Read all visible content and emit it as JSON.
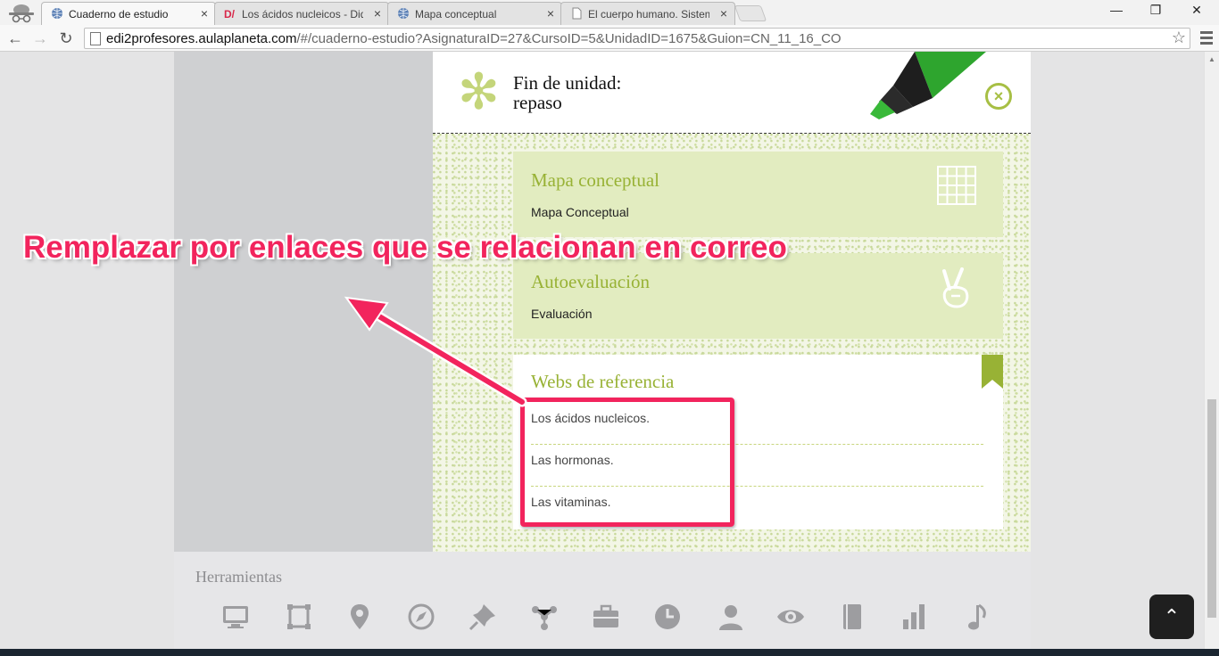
{
  "browser": {
    "tabs": [
      {
        "label": "Cuaderno de estudio",
        "icon": "globe-icon",
        "active": true
      },
      {
        "label": "Los ácidos nucleicos - Did",
        "icon": "d-slash-icon",
        "active": false
      },
      {
        "label": "Mapa conceptual",
        "icon": "globe-icon",
        "active": false
      },
      {
        "label": "El cuerpo humano. Sistem",
        "icon": "document-icon",
        "active": false
      }
    ],
    "tab_close_glyph": "×",
    "window_controls": {
      "minimize": "—",
      "restore": "❐",
      "close": "✕"
    },
    "url_host": "edi2profesores.aulaplaneta.com",
    "url_path": "/#/cuaderno-estudio?AsignaturaID=27&CursoID=5&UnidadID=1675&Guion=CN_11_16_CO",
    "nav": {
      "back": "←",
      "forward": "→",
      "reload": "↻"
    },
    "star_glyph": "☆"
  },
  "panel": {
    "header_title_line1": "Fin de unidad:",
    "header_title_line2": "repaso",
    "asterisk_glyph": "✻",
    "close_glyph": "×",
    "cards": [
      {
        "title": "Mapa conceptual",
        "subtitle": "Mapa Conceptual",
        "icon": "grid-icon"
      },
      {
        "title": "Autoevaluación",
        "subtitle": "Evaluación",
        "icon": "victory-hand-icon"
      }
    ],
    "webs_title": "Webs de referencia",
    "webs_items": [
      "Los ácidos nucleicos.",
      "Las hormonas.",
      "Las vitaminas."
    ]
  },
  "tools": {
    "title": "Herramientas",
    "icons": [
      "monitor-icon",
      "crop-icon",
      "map-pin-icon",
      "compass-icon",
      "pushpin-icon",
      "network-icon",
      "briefcase-icon",
      "clock-icon",
      "user-icon",
      "eye-icon",
      "book-icon",
      "bar-chart-icon",
      "music-note-icon"
    ]
  },
  "scroll_top_glyph": "⌃",
  "annotation": {
    "text": "Remplazar por enlaces que se relacionan en correo",
    "color": "#f2245d"
  },
  "colors": {
    "accent_green": "#98b235",
    "card_bg": "#e2ecc0",
    "annotation_pink": "#f2245d"
  }
}
